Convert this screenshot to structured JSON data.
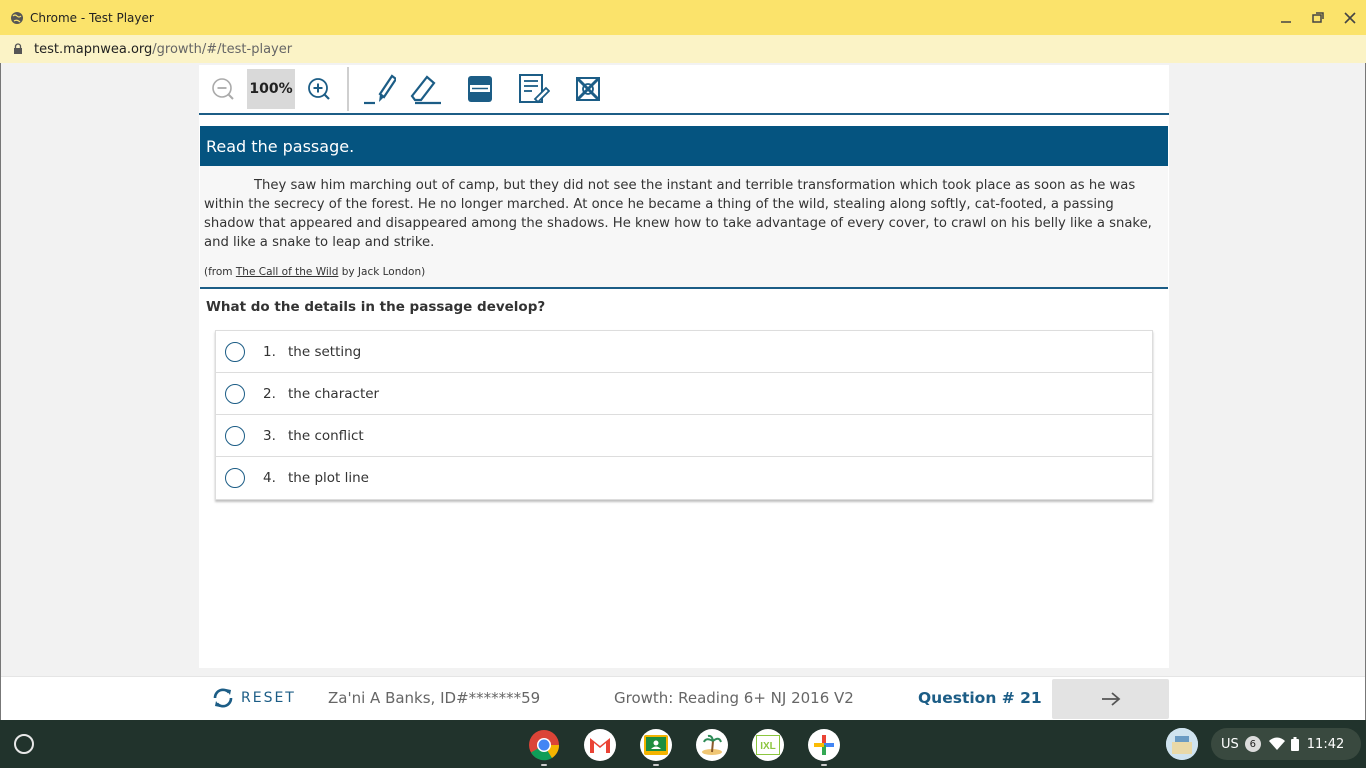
{
  "window": {
    "title": "Chrome - Test Player",
    "url_host": "test.mapnwea.org",
    "url_path": "/growth/#/test-player"
  },
  "toolbar": {
    "zoom_level": "100%",
    "icons": [
      "zoom-out-icon",
      "zoom-in-icon",
      "highlighter-icon",
      "eraser-icon",
      "line-reader-icon",
      "notepad-icon",
      "answer-eliminator-icon"
    ]
  },
  "passage": {
    "header": "Read the passage.",
    "text": "They saw him marching out of camp, but they did not see the instant and terrible transformation which took place as soon as he was within the secrecy of the forest. He no longer marched. At once he became a thing of the wild, stealing along softly, cat-footed, a passing shadow that appeared and disappeared among the shadows. He knew how to take advantage of every cover, to crawl on his belly like a snake, and like a snake to leap and strike.",
    "citation_prefix": "(from ",
    "citation_book": "The Call of the Wild",
    "citation_suffix": " by Jack London)"
  },
  "question": {
    "prompt": "What do the details in the passage develop?",
    "choices": [
      {
        "num": "1.",
        "text": "the setting"
      },
      {
        "num": "2.",
        "text": "the character"
      },
      {
        "num": "3.",
        "text": "the conflict"
      },
      {
        "num": "4.",
        "text": "the plot line"
      }
    ]
  },
  "footer": {
    "reset_label": "RESET",
    "student": "Za'ni A Banks, ID#*******59",
    "test_name": "Growth: Reading 6+ NJ 2016 V2",
    "question_number": "Question # 21"
  },
  "shelf": {
    "apps": [
      "chrome-icon",
      "gmail-icon",
      "classroom-icon",
      "island-app-icon",
      "ixl-icon",
      "add-app-icon"
    ],
    "lang": "US",
    "notification_count": "6",
    "time": "11:42"
  },
  "colors": {
    "titlebar": "#fbe36b",
    "brand_blue": "#055480",
    "accent_blue": "#1c5d86",
    "shelf": "#21332c"
  }
}
